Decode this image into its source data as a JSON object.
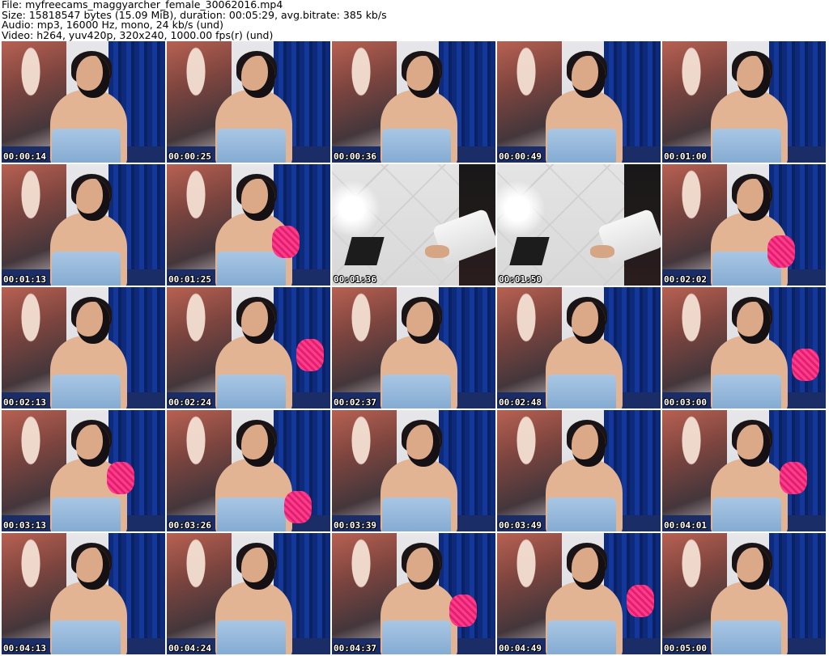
{
  "header": {
    "line1": "File: myfreecams_maggyarcher_female_30062016.mp4",
    "line2": "Size: 15818547 bytes (15.09 MiB), duration: 00:05:29, avg.bitrate: 385 kb/s",
    "line3": "Audio: mp3, 16000 Hz, mono, 24 kb/s (und)",
    "line4": "Video: h264, yuv420p, 320x240, 1000.00 fps(r) (und)"
  },
  "thumbnails": [
    {
      "timestamp": "00:00:14",
      "scene": "person"
    },
    {
      "timestamp": "00:00:25",
      "scene": "person"
    },
    {
      "timestamp": "00:00:36",
      "scene": "person"
    },
    {
      "timestamp": "00:00:49",
      "scene": "person"
    },
    {
      "timestamp": "00:01:00",
      "scene": "person"
    },
    {
      "timestamp": "00:01:13",
      "scene": "person"
    },
    {
      "timestamp": "00:01:25",
      "scene": "person-glove"
    },
    {
      "timestamp": "00:01:36",
      "scene": "floor"
    },
    {
      "timestamp": "00:01:50",
      "scene": "floor"
    },
    {
      "timestamp": "00:02:02",
      "scene": "person-glove"
    },
    {
      "timestamp": "00:02:13",
      "scene": "person"
    },
    {
      "timestamp": "00:02:24",
      "scene": "person-glove"
    },
    {
      "timestamp": "00:02:37",
      "scene": "person"
    },
    {
      "timestamp": "00:02:48",
      "scene": "person"
    },
    {
      "timestamp": "00:03:00",
      "scene": "person-glove"
    },
    {
      "timestamp": "00:03:13",
      "scene": "person-glove"
    },
    {
      "timestamp": "00:03:26",
      "scene": "person-glove"
    },
    {
      "timestamp": "00:03:39",
      "scene": "person"
    },
    {
      "timestamp": "00:03:49",
      "scene": "person"
    },
    {
      "timestamp": "00:04:01",
      "scene": "person-glove"
    },
    {
      "timestamp": "00:04:13",
      "scene": "person"
    },
    {
      "timestamp": "00:04:24",
      "scene": "person"
    },
    {
      "timestamp": "00:04:37",
      "scene": "person-glove"
    },
    {
      "timestamp": "00:04:49",
      "scene": "person-glove"
    },
    {
      "timestamp": "00:05:00",
      "scene": "person"
    }
  ],
  "colors": {
    "background": "#ffffff",
    "timestamp_text": "#ffffff",
    "curtain": "#14379a",
    "towel": "#a9c7e4",
    "glove": "#ff3c8c"
  }
}
